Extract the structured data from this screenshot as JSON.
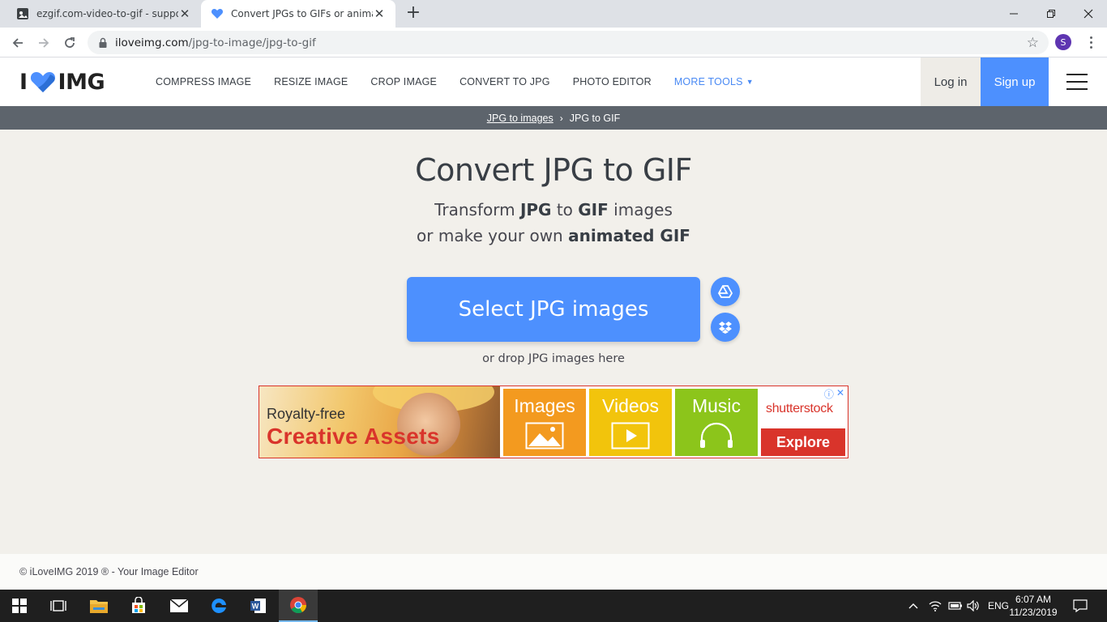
{
  "browser": {
    "tabs": [
      {
        "title": "ezgif.com-video-to-gif - support",
        "active": false
      },
      {
        "title": "Convert JPGs to GIFs or animated",
        "active": true
      }
    ],
    "url_host": "iloveimg.com",
    "url_path": "/jpg-to-image/jpg-to-gif",
    "profile_initial": "S"
  },
  "header": {
    "logo_left": "I",
    "logo_right": "IMG",
    "nav": [
      {
        "label": "COMPRESS IMAGE"
      },
      {
        "label": "RESIZE IMAGE"
      },
      {
        "label": "CROP IMAGE"
      },
      {
        "label": "CONVERT TO JPG"
      },
      {
        "label": "PHOTO EDITOR"
      },
      {
        "label": "MORE TOOLS"
      }
    ],
    "login": "Log in",
    "signup": "Sign up"
  },
  "breadcrumb": {
    "parent": "JPG to images",
    "current": "JPG to GIF"
  },
  "hero": {
    "title": "Convert JPG to GIF",
    "line1_a": "Transform ",
    "line1_b": "JPG",
    "line1_c": " to ",
    "line1_d": "GIF",
    "line1_e": " images",
    "line2_a": "or make your own ",
    "line2_b": "animated GIF",
    "select_button": "Select JPG images",
    "drop_text": "or drop JPG images here"
  },
  "ad": {
    "line1": "Royalty-free",
    "line2": "Creative Assets",
    "tiles": [
      {
        "label": "Images",
        "color": "#f39a1f"
      },
      {
        "label": "Videos",
        "color": "#f2c40c"
      },
      {
        "label": "Music",
        "color": "#8cc51b"
      }
    ],
    "brand": "shutterstock",
    "cta": "Explore"
  },
  "footer": {
    "text": "© iLoveIMG 2019 ® - Your Image Editor"
  },
  "taskbar": {
    "language": "ENG",
    "time": "6:07 AM",
    "date": "11/23/2019"
  },
  "colors": {
    "brand_blue": "#4d90fe",
    "ad_red": "#d9342b",
    "page_bg": "#f2f0eb"
  }
}
